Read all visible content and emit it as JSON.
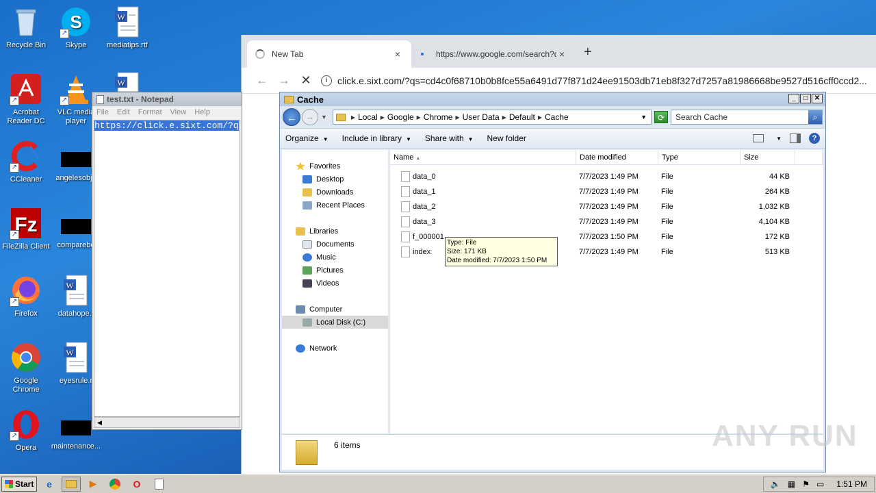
{
  "desktop": {
    "icons": [
      {
        "label": "Recycle Bin",
        "icon": "recycle-bin-icon"
      },
      {
        "label": "Skype",
        "icon": "skype-icon"
      },
      {
        "label": "mediatips.rtf",
        "icon": "word-doc-icon"
      },
      {
        "label": "Acrobat Reader DC",
        "icon": "acrobat-icon"
      },
      {
        "label": "VLC media player",
        "icon": "vlc-icon"
      },
      {
        "label": "CCleaner",
        "icon": "ccleaner-icon"
      },
      {
        "label": "angelesobje",
        "icon": "redacted-icon"
      },
      {
        "label": "FileZilla Client",
        "icon": "filezilla-icon"
      },
      {
        "label": "comparebo",
        "icon": "redacted-icon"
      },
      {
        "label": "Firefox",
        "icon": "firefox-icon"
      },
      {
        "label": "datahope.r",
        "icon": "word-doc-icon"
      },
      {
        "label": "Google Chrome",
        "icon": "chrome-icon"
      },
      {
        "label": "eyesrule.r",
        "icon": "word-doc-icon"
      },
      {
        "label": "Opera",
        "icon": "opera-icon"
      },
      {
        "label": "maintenance...",
        "icon": "redacted-icon"
      }
    ]
  },
  "chrome": {
    "tabs": [
      {
        "title": "New Tab",
        "close": "×"
      },
      {
        "title": "https://www.google.com/search?q=",
        "close": "×"
      }
    ],
    "new_tab": "+",
    "back": "←",
    "forward": "→",
    "stop": "✕",
    "url": "click.e.sixt.com/?qs=cd4c0f68710b0b8fce55a6491d77f871d24ee91503db71eb8f327d7257a81986668be9527d516cff0ccd2..."
  },
  "notepad": {
    "title": "test.txt - Notepad",
    "menu": [
      "File",
      "Edit",
      "Format",
      "View",
      "Help"
    ],
    "content": "https://click.e.sixt.com/?q"
  },
  "explorer": {
    "title": "Cache",
    "breadcrumb": [
      "Local",
      "Google",
      "Chrome",
      "User Data",
      "Default",
      "Cache"
    ],
    "search_placeholder": "Search Cache",
    "commands": [
      {
        "label": "Organize",
        "has_menu": true
      },
      {
        "label": "Include in library",
        "has_menu": true
      },
      {
        "label": "Share with",
        "has_menu": true
      },
      {
        "label": "New folder",
        "has_menu": false
      }
    ],
    "nav": {
      "favorites": {
        "label": "Favorites",
        "items": [
          "Desktop",
          "Downloads",
          "Recent Places"
        ]
      },
      "libraries": {
        "label": "Libraries",
        "items": [
          "Documents",
          "Music",
          "Pictures",
          "Videos"
        ]
      },
      "computer": {
        "label": "Computer",
        "items": [
          "Local Disk (C:)"
        ]
      },
      "network": {
        "label": "Network"
      }
    },
    "columns": [
      "Name",
      "Date modified",
      "Type",
      "Size"
    ],
    "files": [
      {
        "name": "data_0",
        "date": "7/7/2023 1:49 PM",
        "type": "File",
        "size": "44 KB"
      },
      {
        "name": "data_1",
        "date": "7/7/2023 1:49 PM",
        "type": "File",
        "size": "264 KB"
      },
      {
        "name": "data_2",
        "date": "7/7/2023 1:49 PM",
        "type": "File",
        "size": "1,032 KB"
      },
      {
        "name": "data_3",
        "date": "7/7/2023 1:49 PM",
        "type": "File",
        "size": "4,104 KB"
      },
      {
        "name": "f_000001",
        "date": "7/7/2023 1:50 PM",
        "type": "File",
        "size": "172 KB"
      },
      {
        "name": "index",
        "date": "7/7/2023 1:49 PM",
        "type": "File",
        "size": "513 KB"
      }
    ],
    "tooltip": {
      "type": "Type: File",
      "size": "Size: 171 KB",
      "date": "Date modified: 7/7/2023 1:50 PM"
    },
    "status": "6 items"
  },
  "taskbar": {
    "start": "Start",
    "clock": "1:51 PM"
  },
  "watermark": "ANY RUN"
}
